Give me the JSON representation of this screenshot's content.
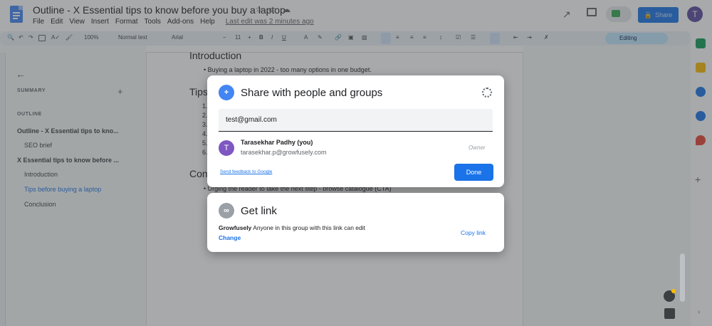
{
  "header": {
    "doc_title": "Outline - X Essential tips to know before you buy a laptop",
    "last_edit": "Last edit was 2 minutes ago",
    "menu": [
      "File",
      "Edit",
      "View",
      "Insert",
      "Format",
      "Tools",
      "Add-ons",
      "Help"
    ],
    "share_label": "Share",
    "avatar_initial": "T"
  },
  "toolbar": {
    "zoom": "100%",
    "style": "Normal text",
    "font": "Arial",
    "font_size": "11",
    "mode": "Editing"
  },
  "outline": {
    "summary_label": "SUMMARY",
    "outline_label": "OUTLINE",
    "items": [
      {
        "label": "Outline - X Essential tips to kno..."
      },
      {
        "label": "SEO brief"
      },
      {
        "label": "X Essential tips to know before ..."
      },
      {
        "label": "Introduction"
      },
      {
        "label": "Tips before buying a laptop"
      },
      {
        "label": "Conclusion"
      }
    ]
  },
  "document": {
    "intro_heading": "Introduction",
    "intro_bullet": "Buying a laptop in 2022 - too many options in one budget.",
    "tips_heading": "Tips",
    "numbers": [
      "1.",
      "2.",
      "3.",
      "4.",
      "5.",
      "6."
    ],
    "conclusion_heading": "Con",
    "conclusion_bullet": "Urging the reader to take the next step - browse catalogue (CTA)"
  },
  "share_dialog": {
    "title": "Share with people and groups",
    "email_value": "test@gmail.com",
    "person_initial": "T",
    "person_name": "Tarasekhar Padhy (you)",
    "person_email": "tarasekhar.p@growfusely.com",
    "person_role": "Owner",
    "feedback_link": "Send feedback to Google",
    "done_label": "Done"
  },
  "link_dialog": {
    "title": "Get link",
    "group": "Growfusely",
    "description": "Anyone in this group with this link can edit",
    "change_label": "Change",
    "copy_label": "Copy link"
  },
  "colors": {
    "accent": "#1a73e8",
    "share_icon_bg": "#4285f4",
    "link_icon_bg": "#9aa0a6",
    "avatar": "#7e57c2"
  }
}
